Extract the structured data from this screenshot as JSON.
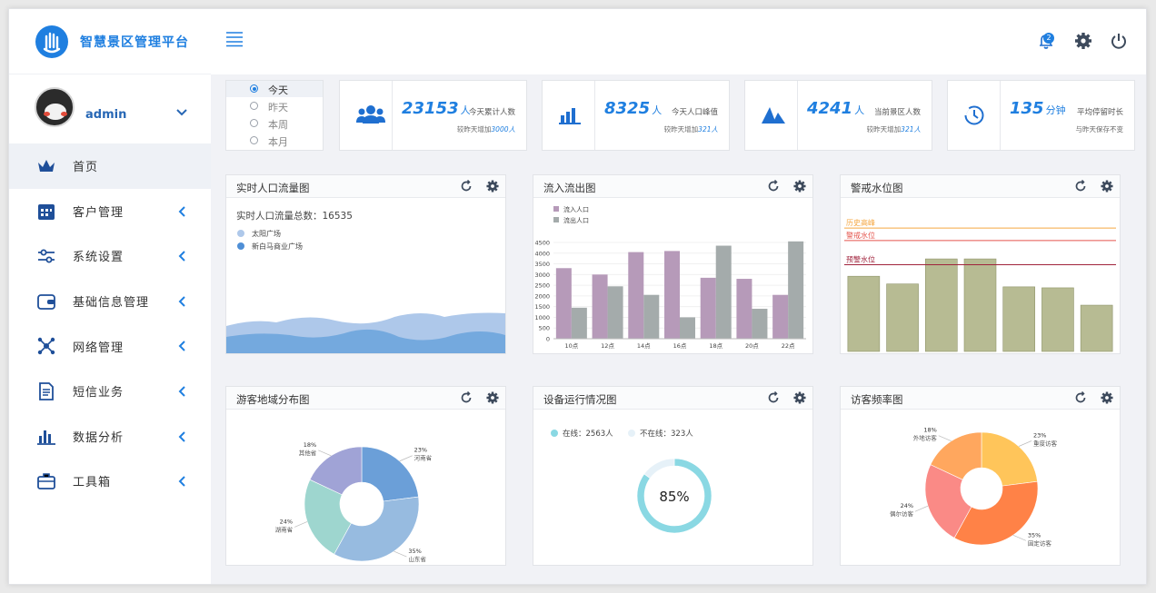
{
  "app": {
    "title": "智慧景区管理平台"
  },
  "user": {
    "name": "admin"
  },
  "sidebar": {
    "items": [
      {
        "label": "首页",
        "icon": "crown-icon",
        "active": true
      },
      {
        "label": "客户管理",
        "icon": "calendar-icon"
      },
      {
        "label": "系统设置",
        "icon": "sliders-icon"
      },
      {
        "label": "基础信息管理",
        "icon": "wallet-icon"
      },
      {
        "label": "网络管理",
        "icon": "network-icon"
      },
      {
        "label": "短信业务",
        "icon": "document-icon"
      },
      {
        "label": "数据分析",
        "icon": "bar-chart-icon"
      },
      {
        "label": "工具箱",
        "icon": "toolbox-icon"
      }
    ]
  },
  "topbar": {
    "notification_count": "2"
  },
  "period": {
    "options": [
      "今天",
      "昨天",
      "本周",
      "本月"
    ],
    "selected": "今天"
  },
  "stats": [
    {
      "value": "23153",
      "unit": "人",
      "label": "今天累计人数",
      "sub_prefix": "较昨天增加",
      "sub_value": "3000人",
      "icon": "users-icon"
    },
    {
      "value": "8325",
      "unit": "人",
      "label": "今天人口峰值",
      "sub_prefix": "较昨天增加",
      "sub_value": "321人",
      "icon": "bar-chart-icon"
    },
    {
      "value": "4241",
      "unit": "人",
      "label": "当前景区人数",
      "sub_prefix": "较昨天增加",
      "sub_value": "321人",
      "icon": "mountain-icon"
    },
    {
      "value": "135",
      "unit": "分钟",
      "label": "平均停留时长",
      "sub_prefix": "与昨天保存不变",
      "sub_value": "",
      "icon": "clock-icon"
    }
  ],
  "panels": {
    "realtime": {
      "title": "实时人口流量图",
      "total_label": "实时人口流量总数：16535",
      "legend": [
        "太阳广场",
        "新白马商业广场"
      ]
    },
    "inout": {
      "title": "流入流出图",
      "legend": [
        "流入人口",
        "流出人口"
      ]
    },
    "alert": {
      "title": "警戒水位图",
      "lines": [
        "历史高峰",
        "警戒水位",
        "预警水位"
      ]
    },
    "region": {
      "title": "游客地域分布图"
    },
    "device": {
      "title": "设备运行情况图",
      "online": "在线：2563人",
      "offline": "不在线：323人",
      "percent": "85%"
    },
    "frequency": {
      "title": "访客频率图"
    }
  },
  "chart_data": [
    {
      "type": "area",
      "title": "实时人口流量图",
      "series": [
        {
          "name": "太阳广场"
        },
        {
          "name": "新白马商业广场"
        }
      ],
      "colors": [
        "#aec8ea",
        "#6aa3dc"
      ]
    },
    {
      "type": "bar",
      "title": "流入流出图",
      "categories": [
        "10点",
        "12点",
        "14点",
        "16点",
        "18点",
        "20点",
        "22点"
      ],
      "series": [
        {
          "name": "流入人口",
          "values": [
            3300,
            3000,
            4050,
            4100,
            2850,
            2800,
            2050
          ],
          "color": "#b69ab9"
        },
        {
          "name": "流出人口",
          "values": [
            1450,
            2450,
            2050,
            1000,
            4350,
            1400,
            4550
          ],
          "color": "#a4abab"
        }
      ],
      "ylim": [
        0,
        4500
      ],
      "yticks": [
        0,
        500,
        1000,
        1500,
        2000,
        2500,
        3000,
        3500,
        4000,
        4500
      ]
    },
    {
      "type": "bar",
      "title": "警戒水位图",
      "values": [
        78,
        70,
        96,
        96,
        67,
        66,
        48
      ],
      "ylim": [
        0,
        130
      ],
      "reference_lines": [
        {
          "name": "历史高峰",
          "value": 128,
          "color": "#f5a742"
        },
        {
          "name": "警戒水位",
          "value": 115,
          "color": "#e5554d"
        },
        {
          "name": "预警水位",
          "value": 90,
          "color": "#a0233c"
        }
      ],
      "color": "#b7bb93"
    },
    {
      "type": "pie",
      "title": "游客地域分布图",
      "slices": [
        {
          "name": "河南省",
          "value": 23,
          "label": "23%",
          "color": "#6b9fd8"
        },
        {
          "name": "山东省",
          "value": 35,
          "label": "35%",
          "color": "#97bbe0"
        },
        {
          "name": "湖南省",
          "value": 24,
          "label": "24%",
          "color": "#9ed6cf"
        },
        {
          "name": "其他省",
          "value": 18,
          "label": "18%",
          "color": "#a0a3d6"
        }
      ]
    },
    {
      "type": "pie",
      "title": "设备运行情况图",
      "slices": [
        {
          "name": "在线",
          "value": 85,
          "color": "#8ad8e3"
        },
        {
          "name": "不在线",
          "value": 15,
          "color": "#e6f1f8"
        }
      ]
    },
    {
      "type": "pie",
      "title": "访客频率图",
      "slices": [
        {
          "name": "重度访客",
          "value": 23,
          "label": "23%",
          "color": "#ffc55a"
        },
        {
          "name": "固定访客",
          "value": 35,
          "label": "35%",
          "color": "#ff8247"
        },
        {
          "name": "偶尔访客",
          "value": 24,
          "label": "24%",
          "color": "#fa8a86"
        },
        {
          "name": "外地访客",
          "value": 18,
          "label": "18%",
          "color": "#ffa75e"
        }
      ]
    }
  ]
}
